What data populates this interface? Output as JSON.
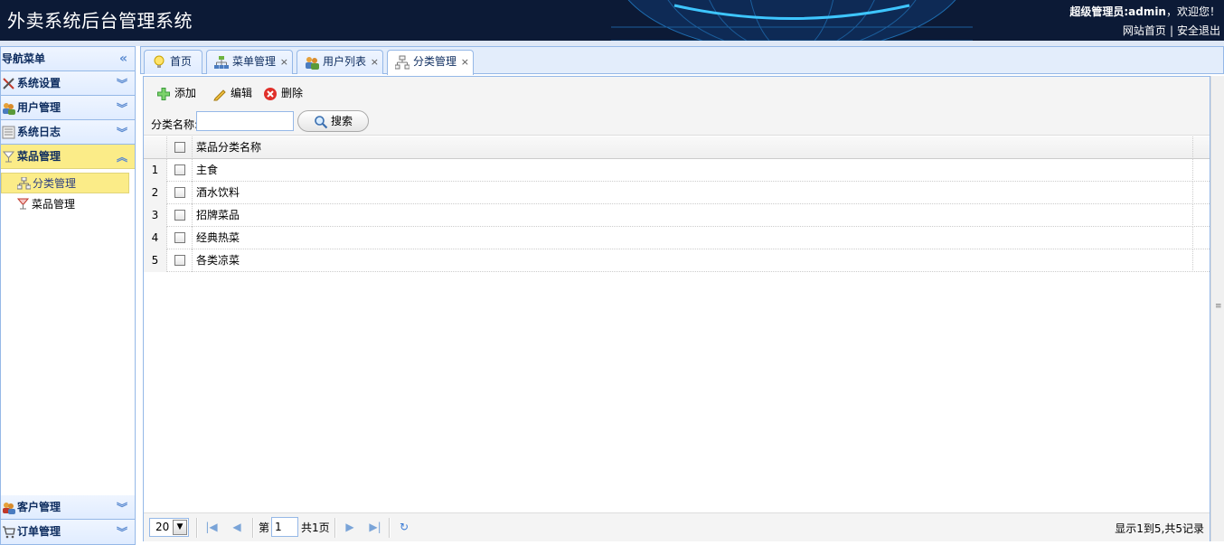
{
  "header": {
    "title": "外卖系统后台管理系统",
    "user_role_label": "超级管理员:",
    "username": "admin",
    "welcome": "，欢迎您！",
    "link_home": "网站首页",
    "link_sep": "|",
    "link_logout": "安全退出"
  },
  "sidebar": {
    "title": "导航菜单",
    "panels": [
      {
        "label": "系统设置"
      },
      {
        "label": "用户管理"
      },
      {
        "label": "系统日志"
      },
      {
        "label": "菜品管理"
      }
    ],
    "menu_items": [
      {
        "label": "分类管理"
      },
      {
        "label": "菜品管理"
      }
    ],
    "bottom_panels": [
      {
        "label": "客户管理"
      },
      {
        "label": "订单管理"
      }
    ]
  },
  "tabs": [
    {
      "label": "首页"
    },
    {
      "label": "菜单管理",
      "close": "×"
    },
    {
      "label": "用户列表",
      "close": "×"
    },
    {
      "label": "分类管理",
      "close": "×"
    }
  ],
  "toolbar": {
    "add_label": "添加",
    "edit_label": "编辑",
    "delete_label": "删除",
    "search_label": "分类名称:",
    "search_value": "",
    "search_button": "搜索"
  },
  "grid": {
    "column_name": "菜品分类名称",
    "rows": [
      {
        "num": "1",
        "name": "主食"
      },
      {
        "num": "2",
        "name": "酒水饮料"
      },
      {
        "num": "3",
        "name": "招牌菜品"
      },
      {
        "num": "4",
        "name": "经典热菜"
      },
      {
        "num": "5",
        "name": "各类凉菜"
      }
    ]
  },
  "pager": {
    "page_size": "20",
    "page_prefix": "第",
    "current_page": "1",
    "page_total": "共1页",
    "info": "显示1到5,共5记录"
  },
  "colors": {
    "header_bg": "#0c1a36",
    "border": "#95b8e7",
    "selected": "#fbec88"
  }
}
